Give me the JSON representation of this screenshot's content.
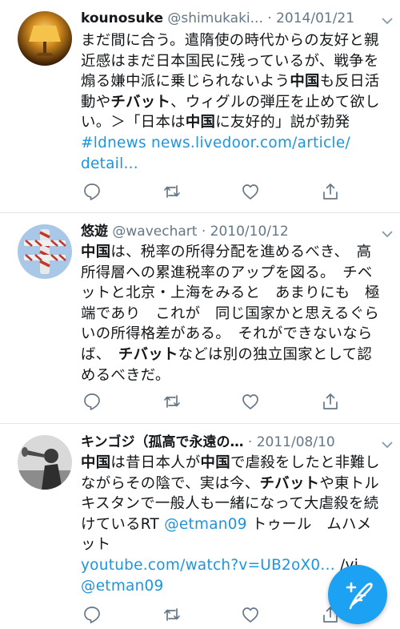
{
  "colors": {
    "accent": "#1da1f2",
    "link": "#1b95e0",
    "secondary_text": "#657786",
    "divider": "#e1e8ed"
  },
  "tweets": [
    {
      "name": "kounosuke",
      "handle": "@shimukaki...",
      "separator": "·",
      "date": "2014/01/21",
      "avatar_icon": "lamp-avatar",
      "text": [
        "まだ間に合う。遣隋使の時代からの友好と親",
        "近感はまだ日本国民に残っているが、戦争を",
        "煽る嫌中派に乗じられないよう",
        "中国",
        "も反日活",
        "動や",
        "チバット",
        "、ウィグルの弾圧を止めて欲し",
        "い。＞「日本は",
        "中国",
        "に友好的」説が勃発"
      ],
      "links": [
        "#ldnews",
        "news.livedoor.com/article/",
        "detail..."
      ]
    },
    {
      "name": "悠遊",
      "handle": "@wavechart",
      "separator": "·",
      "date": "2010/10/12",
      "avatar_icon": "biplane-avatar",
      "text": [
        "中国",
        "は、税率の所得分配を進めるべき、　高",
        "所得層への累進税率のアップを図る。　チベ",
        "ットと北京・上海をみると　あまりにも　極",
        "端であり　これが　同じ国家かと思えるぐら",
        "いの所得格差がある。　それができないなら",
        "ば、　",
        "チバット",
        "などは別の独立国家として",
        "認めるべきだ。"
      ]
    },
    {
      "name": "キンゴジ（孤高で永遠の…",
      "separator": "·",
      "date": "2011/08/10",
      "avatar_icon": "bugler-avatar",
      "text": [
        "中国",
        "は昔日本人が",
        "中国",
        "で虐殺をしたと非難し",
        "ながらその陰で、実は今、",
        "チバット",
        "や東トル",
        "キスタンで一般人も一緒になって大虐殺を続",
        "けているRT ",
        "@etman09",
        " トゥール　ムハメ",
        "ット",
        "youtube.com/watch?v=UB2oX0...",
        " /vi",
        "@etman09"
      ]
    }
  ],
  "actions": {
    "reply_icon": "reply-icon",
    "retweet_icon": "retweet-icon",
    "like_icon": "heart-icon",
    "share_icon": "share-icon"
  },
  "compose_button_icon": "compose-tweet-icon"
}
